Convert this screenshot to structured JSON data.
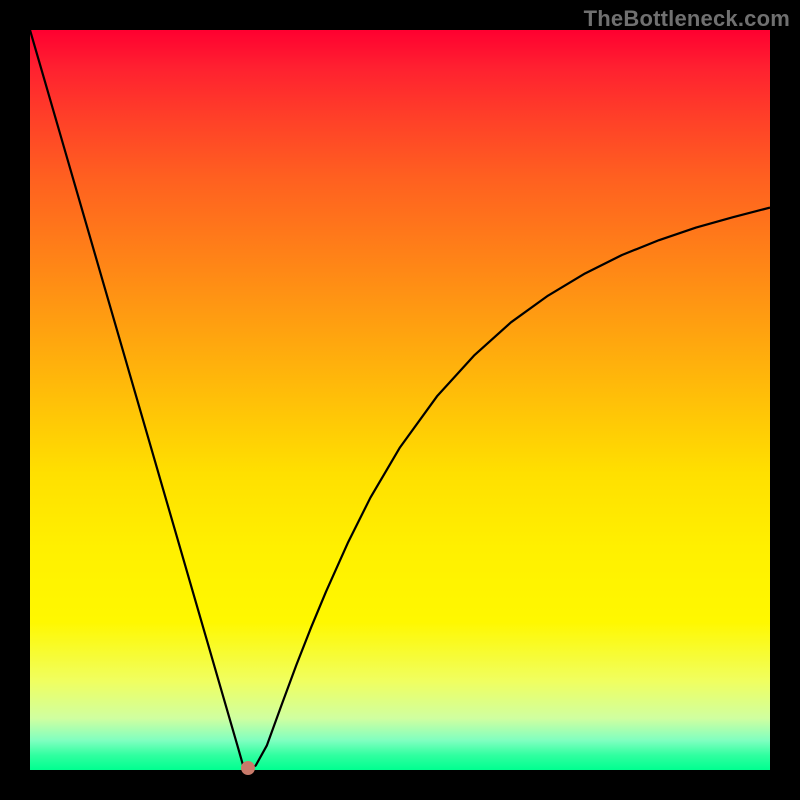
{
  "watermark": "TheBottleneck.com",
  "chart_data": {
    "type": "line",
    "title": "",
    "xlabel": "",
    "ylabel": "",
    "xlim": [
      0,
      100
    ],
    "ylim": [
      0,
      100
    ],
    "grid": false,
    "legend": false,
    "background": "rainbow-vertical-gradient",
    "series": [
      {
        "name": "bottleneck-curve",
        "color": "#000000",
        "x": [
          0,
          2,
          4,
          6,
          8,
          10,
          12,
          14,
          16,
          18,
          20,
          22,
          24,
          26,
          28,
          28.8,
          29.5,
          30.5,
          32,
          34,
          36,
          38,
          40,
          43,
          46,
          50,
          55,
          60,
          65,
          70,
          75,
          80,
          85,
          90,
          95,
          100
        ],
        "y": [
          100,
          93.1,
          86.2,
          79.3,
          72.4,
          65.5,
          58.6,
          51.7,
          44.8,
          37.9,
          31.0,
          24.1,
          17.2,
          10.3,
          3.4,
          0.6,
          0.1,
          0.6,
          3.3,
          8.8,
          14.2,
          19.3,
          24.1,
          30.8,
          36.8,
          43.6,
          50.5,
          56.0,
          60.5,
          64.1,
          67.1,
          69.6,
          71.6,
          73.3,
          74.7,
          76.0
        ]
      }
    ],
    "marker": {
      "x": 29.5,
      "y": 0.3,
      "color": "#c97a6a"
    }
  },
  "colors": {
    "frame": "#000000",
    "gradient_top": "#ff0030",
    "gradient_bottom": "#00ff90",
    "curve": "#000000",
    "marker": "#c97a6a"
  }
}
